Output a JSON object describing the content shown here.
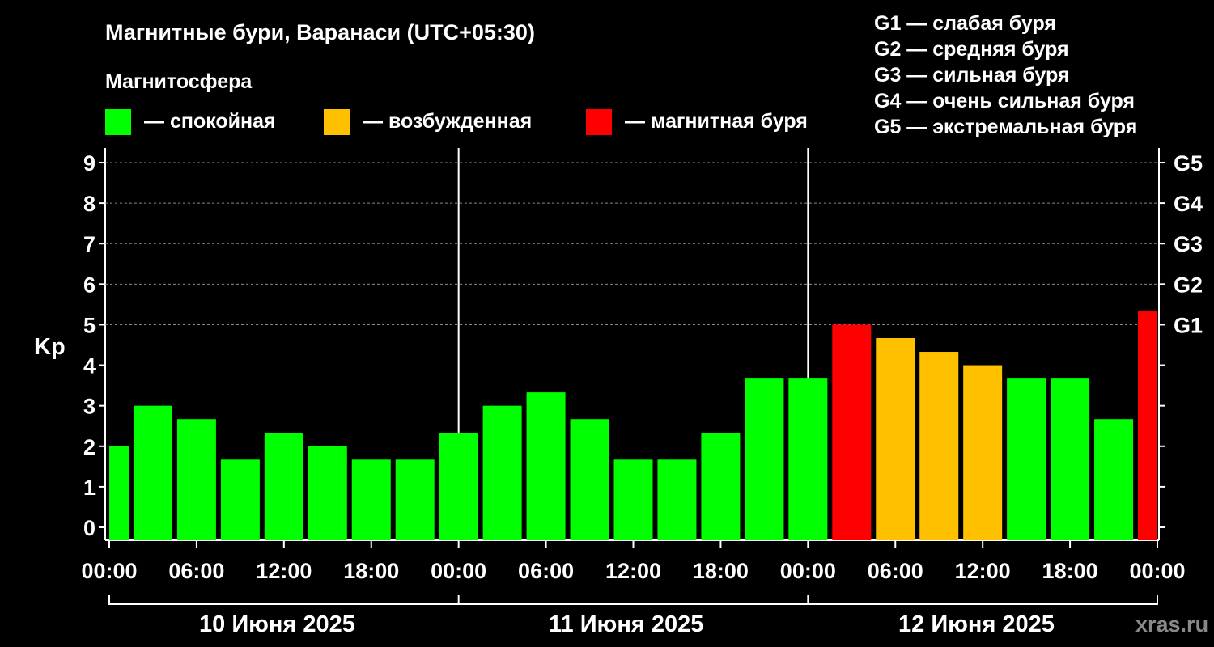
{
  "title": "Магнитные бури, Варанаси (UTC+05:30)",
  "legend": {
    "heading": "Магнитосфера",
    "items": [
      {
        "label": "— спокойная",
        "color": "#00ff00"
      },
      {
        "label": "— возбужденная",
        "color": "#ffc000"
      },
      {
        "label": "— магнитная буря",
        "color": "#ff0000"
      }
    ],
    "g_scale": [
      "G1 — слабая буря",
      "G2 — средняя буря",
      "G3 — сильная буря",
      "G4 — очень сильная буря",
      "G5 — экстремальная буря"
    ]
  },
  "watermark": "xras.ru",
  "chart_data": {
    "type": "bar",
    "ylabel": "Kp",
    "ylim": [
      0,
      9
    ],
    "yticks": [
      "0",
      "1",
      "2",
      "3",
      "4",
      "5",
      "6",
      "7",
      "8",
      "9"
    ],
    "right_ticks": [
      {
        "label": "G1",
        "value": 5
      },
      {
        "label": "G2",
        "value": 6
      },
      {
        "label": "G3",
        "value": 7
      },
      {
        "label": "G4",
        "value": 8
      },
      {
        "label": "G5",
        "value": 9
      }
    ],
    "xticks": [
      "00:00",
      "06:00",
      "12:00",
      "18:00",
      "00:00",
      "06:00",
      "12:00",
      "18:00",
      "00:00",
      "06:00",
      "12:00",
      "18:00",
      "00:00"
    ],
    "days": [
      "10 Июня 2025",
      "11 Июня 2025",
      "12 Июня 2025"
    ],
    "grid": true,
    "colors": {
      "quiet": "#00ff00",
      "active": "#ffc000",
      "storm": "#ff0000"
    },
    "bars": [
      {
        "time": "10 Июня 2025 00:00",
        "value": 2.0,
        "status": "quiet"
      },
      {
        "time": "10 Июня 2025 03:00",
        "value": 3.0,
        "status": "quiet"
      },
      {
        "time": "10 Июня 2025 06:00",
        "value": 2.67,
        "status": "quiet"
      },
      {
        "time": "10 Июня 2025 09:00",
        "value": 1.67,
        "status": "quiet"
      },
      {
        "time": "10 Июня 2025 12:00",
        "value": 2.33,
        "status": "quiet"
      },
      {
        "time": "10 Июня 2025 15:00",
        "value": 2.0,
        "status": "quiet"
      },
      {
        "time": "10 Июня 2025 18:00",
        "value": 1.67,
        "status": "quiet"
      },
      {
        "time": "10 Июня 2025 21:00",
        "value": 1.67,
        "status": "quiet"
      },
      {
        "time": "11 Июня 2025 00:00",
        "value": 2.33,
        "status": "quiet"
      },
      {
        "time": "11 Июня 2025 03:00",
        "value": 3.0,
        "status": "quiet"
      },
      {
        "time": "11 Июня 2025 06:00",
        "value": 3.33,
        "status": "quiet"
      },
      {
        "time": "11 Июня 2025 09:00",
        "value": 2.67,
        "status": "quiet"
      },
      {
        "time": "11 Июня 2025 12:00",
        "value": 1.67,
        "status": "quiet"
      },
      {
        "time": "11 Июня 2025 15:00",
        "value": 1.67,
        "status": "quiet"
      },
      {
        "time": "11 Июня 2025 18:00",
        "value": 2.33,
        "status": "quiet"
      },
      {
        "time": "11 Июня 2025 21:00",
        "value": 3.67,
        "status": "quiet"
      },
      {
        "time": "12 Июня 2025 00:00",
        "value": 3.67,
        "status": "quiet"
      },
      {
        "time": "12 Июня 2025 03:00",
        "value": 5.0,
        "status": "storm"
      },
      {
        "time": "12 Июня 2025 06:00",
        "value": 4.67,
        "status": "active"
      },
      {
        "time": "12 Июня 2025 09:00",
        "value": 4.33,
        "status": "active"
      },
      {
        "time": "12 Июня 2025 12:00",
        "value": 4.0,
        "status": "active"
      },
      {
        "time": "12 Июня 2025 15:00",
        "value": 3.67,
        "status": "quiet"
      },
      {
        "time": "12 Июня 2025 18:00",
        "value": 3.67,
        "status": "quiet"
      },
      {
        "time": "12 Июня 2025 21:00",
        "value": 2.67,
        "status": "quiet"
      },
      {
        "time": "13 Июня 2025 00:00",
        "value": 5.33,
        "status": "storm"
      }
    ]
  }
}
